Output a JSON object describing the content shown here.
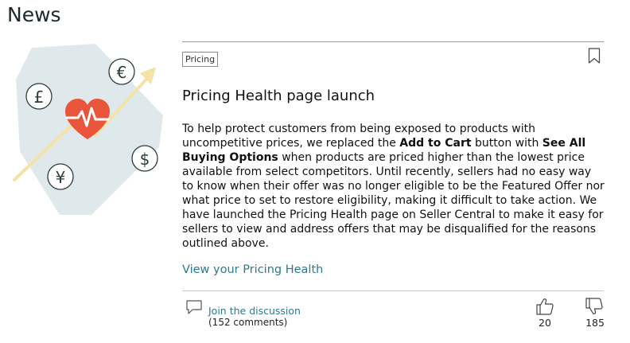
{
  "section": {
    "title": "News"
  },
  "article": {
    "tag": "Pricing",
    "headline": "Pricing Health page launch",
    "body": {
      "p1": "To help protect customers from being exposed to products with uncompetitive prices, we replaced the ",
      "b1": "Add to Cart",
      "p2": " button with ",
      "b2": "See All Buying Options",
      "p3": " when products are priced higher than the lowest price available from select competitors. Until recently, sellers had no easy way to know when their offer was no longer eligible to be the Featured Offer nor what price to set to restore eligibility, making it difficult to take action. We have launched the Pricing Health page on Seller Central to make it easy for sellers to view and address offers that may be disqualified for the reasons outlined above."
    },
    "link": "View your Pricing Health"
  },
  "footer": {
    "join_label": "Join the discussion",
    "comments_label": "(152 comments)",
    "upvotes": "20",
    "downvotes": "185"
  },
  "illustration": {
    "currency_symbols": [
      "€",
      "£",
      "$",
      "¥"
    ],
    "heart_color": "#e8553a",
    "tag_color": "#dfe8ea",
    "arrow_color": "#f3e3a6",
    "icon_stroke": "#2a3a3a"
  },
  "icons": {
    "bookmark": "bookmark-icon",
    "comment": "comment-icon",
    "thumbs_up": "thumbs-up-icon",
    "thumbs_down": "thumbs-down-icon"
  }
}
